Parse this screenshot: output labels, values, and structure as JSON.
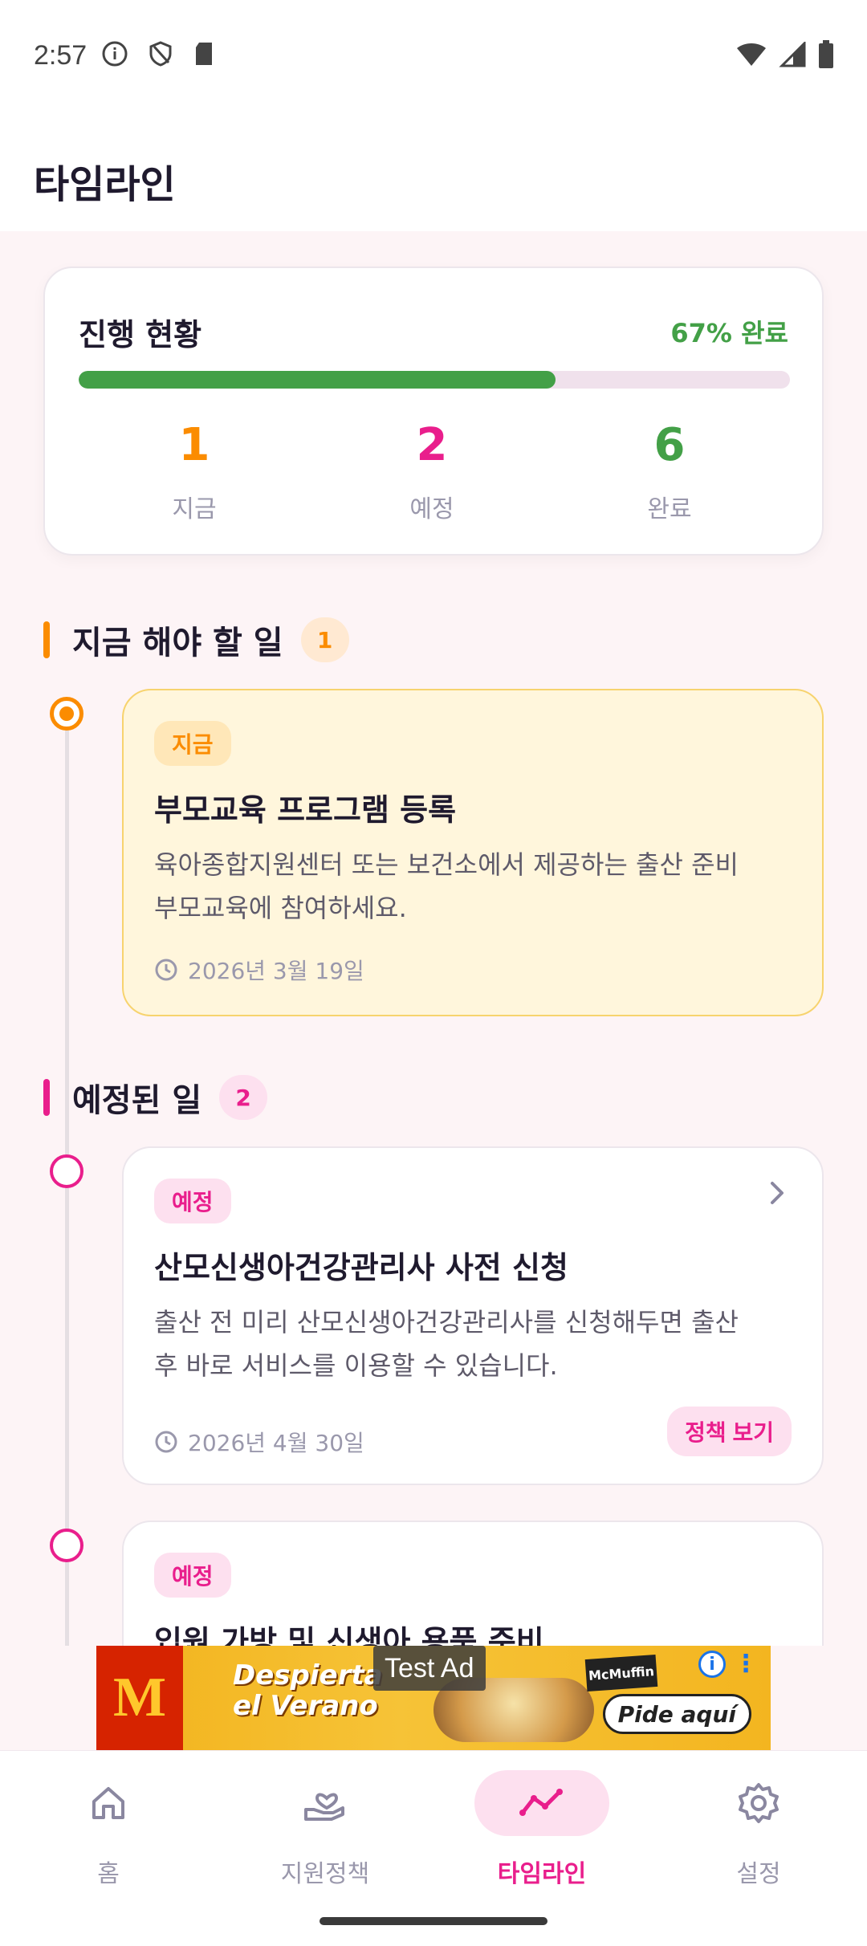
{
  "status_bar": {
    "time": "2:57"
  },
  "header": {
    "title": "타임라인"
  },
  "progress": {
    "title": "진행 현황",
    "percent_label": "67% 완료",
    "fraction": 0.67,
    "fill_color": "#43a047",
    "stats": [
      {
        "value": "1",
        "label": "지금",
        "color": "#fb8c00"
      },
      {
        "value": "2",
        "label": "예정",
        "color": "#e91e8c"
      },
      {
        "value": "6",
        "label": "완료",
        "color": "#43a047"
      }
    ]
  },
  "now_section": {
    "title": "지금 해야 할 일",
    "count": "1",
    "accent": "#fb8c00",
    "card": {
      "tag": "지금",
      "title": "부모교육 프로그램 등록",
      "desc_line1": "육아종합지원센터 또는 보건소에서 제공하는 출산 준비",
      "desc_line2": "부모교육에 참여하세요.",
      "date": "2026년 3월 19일"
    }
  },
  "upcoming_section": {
    "title": "예정된 일",
    "count": "2",
    "accent": "#e91e8c",
    "cards": [
      {
        "tag": "예정",
        "title": "산모신생아건강관리사 사전 신청",
        "desc_line1": "출산 전 미리 산모신생아건강관리사를 신청해두면 출산",
        "desc_line2": "후 바로 서비스를 이용할 수 있습니다.",
        "date": "2026년 4월 30일",
        "action": "정책 보기"
      },
      {
        "tag": "예정",
        "title": "입원 가방 및 신생아 용품 준비"
      }
    ]
  },
  "ad": {
    "label": "Test Ad",
    "headline_1": "Despierta",
    "headline_2": "el Verano",
    "product": "McMuffin",
    "cta": "Pide aquí",
    "logo": "M"
  },
  "nav": {
    "items": [
      {
        "label": "홈",
        "icon": "home-icon"
      },
      {
        "label": "지원정책",
        "icon": "support-hand-icon"
      },
      {
        "label": "타임라인",
        "icon": "timeline-icon",
        "active": true
      },
      {
        "label": "설정",
        "icon": "gear-icon"
      }
    ],
    "active_color": "#e91e8c"
  }
}
